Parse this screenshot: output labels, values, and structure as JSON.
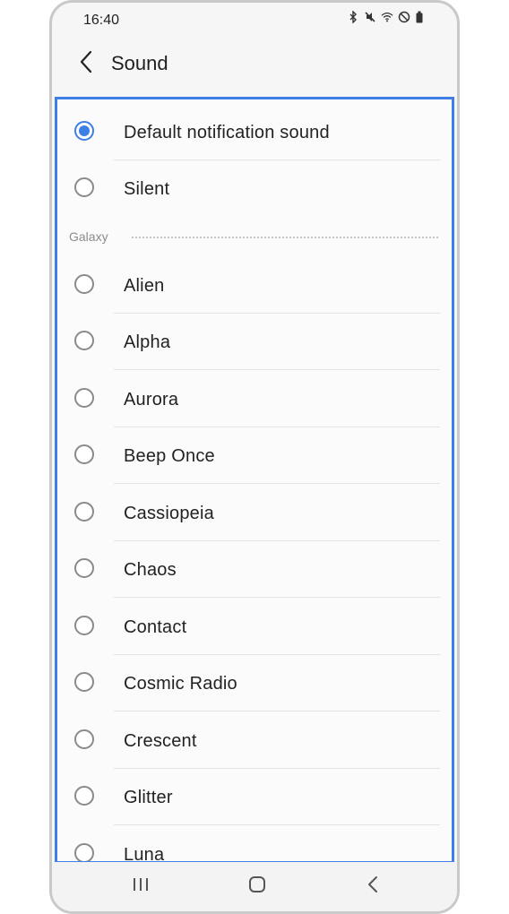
{
  "status_bar": {
    "time": "16:40",
    "icons": [
      "bluetooth-icon",
      "mute-icon",
      "wifi-icon",
      "do-not-disturb-icon",
      "battery-icon"
    ]
  },
  "header": {
    "title": "Sound",
    "back_icon": "chevron-left-icon"
  },
  "sound_list": {
    "selected": "Default notification sound",
    "top_items": [
      {
        "label": "Default notification sound",
        "checked": true
      },
      {
        "label": "Silent",
        "checked": false
      }
    ],
    "section": {
      "label": "Galaxy",
      "items": [
        {
          "label": "Alien",
          "checked": false
        },
        {
          "label": "Alpha",
          "checked": false
        },
        {
          "label": "Aurora",
          "checked": false
        },
        {
          "label": "Beep Once",
          "checked": false
        },
        {
          "label": "Cassiopeia",
          "checked": false
        },
        {
          "label": "Chaos",
          "checked": false
        },
        {
          "label": "Contact",
          "checked": false
        },
        {
          "label": "Cosmic Radio",
          "checked": false
        },
        {
          "label": "Crescent",
          "checked": false
        },
        {
          "label": "Glitter",
          "checked": false
        },
        {
          "label": "Luna",
          "checked": false
        }
      ]
    }
  },
  "nav_bar": {
    "buttons": [
      "recent-apps-icon",
      "home-icon",
      "back-icon"
    ]
  },
  "colors": {
    "accent": "#3d7fe6",
    "highlight_border": "#3d7fe6",
    "text": "#222222",
    "section_text": "#8c8c8c"
  }
}
